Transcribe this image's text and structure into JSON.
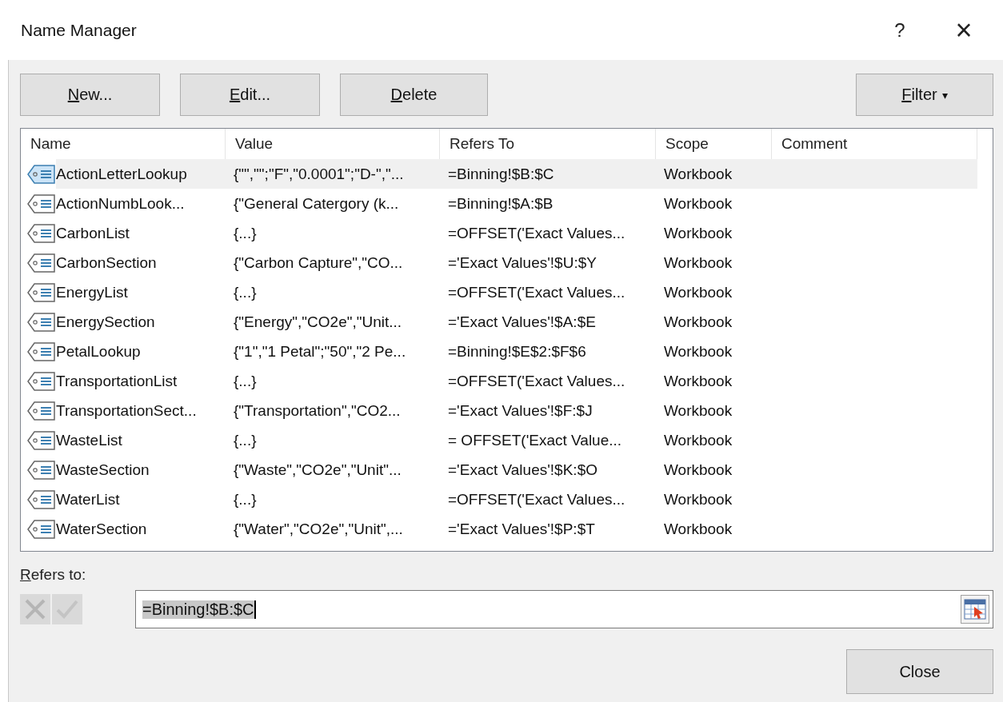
{
  "window": {
    "title": "Name Manager",
    "help": "?",
    "close": "×"
  },
  "buttons": [
    {
      "label": "New...",
      "disabled": false
    },
    {
      "label": "Edit...",
      "disabled": false
    },
    {
      "label": "Delete",
      "disabled": false
    }
  ],
  "filter": {
    "label": "Filter",
    "caret": "▾"
  },
  "table": {
    "columns": [
      "Name",
      "Value",
      "Refers To",
      "Scope",
      "Comment"
    ],
    "rows": [
      {
        "name": "ActionLetterLookup",
        "value": "{\"\",\"\";\"F\",\"0.0001\";\"D-\",\"...",
        "refers_to": "=Binning!$B:$C",
        "scope": "Workbook",
        "selected": true
      },
      {
        "name": "ActionNumbLook...",
        "value": "{\"General Catergory (k...",
        "refers_to": "=Binning!$A:$B",
        "scope": "Workbook",
        "selected": false
      },
      {
        "name": "CarbonList",
        "value": "{...}",
        "refers_to": "=OFFSET('Exact Values...",
        "scope": "Workbook",
        "selected": false
      },
      {
        "name": "CarbonSection",
        "value": "{\"Carbon Capture\",\"CO...",
        "refers_to": "='Exact Values'!$U:$Y",
        "scope": "Workbook",
        "selected": false
      },
      {
        "name": "EnergyList",
        "value": "{...}",
        "refers_to": "=OFFSET('Exact Values...",
        "scope": "Workbook",
        "selected": false
      },
      {
        "name": "EnergySection",
        "value": "{\"Energy\",\"CO2e\",\"Unit...",
        "refers_to": "='Exact Values'!$A:$E",
        "scope": "Workbook",
        "selected": false
      },
      {
        "name": "PetalLookup",
        "value": "{\"1\",\"1 Petal\";\"50\",\"2 Pe...",
        "refers_to": "=Binning!$E$2:$F$6",
        "scope": "Workbook",
        "selected": false
      },
      {
        "name": "TransportationList",
        "value": "{...}",
        "refers_to": "=OFFSET('Exact Values...",
        "scope": "Workbook",
        "selected": false
      },
      {
        "name": "TransportationSect...",
        "value": "{\"Transportation\",\"CO2...",
        "refers_to": "='Exact Values'!$F:$J",
        "scope": "Workbook",
        "selected": false
      },
      {
        "name": "WasteList",
        "value": "{...}",
        "refers_to": "= OFFSET('Exact Value...",
        "scope": "Workbook",
        "selected": false
      },
      {
        "name": "WasteSection",
        "value": "{\"Waste\",\"CO2e\",\"Unit\"...",
        "refers_to": "='Exact Values'!$K:$O",
        "scope": "Workbook",
        "selected": false
      },
      {
        "name": "WaterList",
        "value": "{...}",
        "refers_to": "=OFFSET('Exact Values...",
        "scope": "Workbook",
        "selected": false
      },
      {
        "name": "WaterSection",
        "value": "{\"Water\",\"CO2e\",\"Unit\",...",
        "refers_to": "='Exact Values'!$P:$T",
        "scope": "Workbook",
        "selected": false
      }
    ]
  },
  "refers_to": {
    "label": "Refers to:",
    "value": "=Binning!$B:$C",
    "cancel_disabled": true,
    "accept_disabled": true
  },
  "close_button": "Close"
}
